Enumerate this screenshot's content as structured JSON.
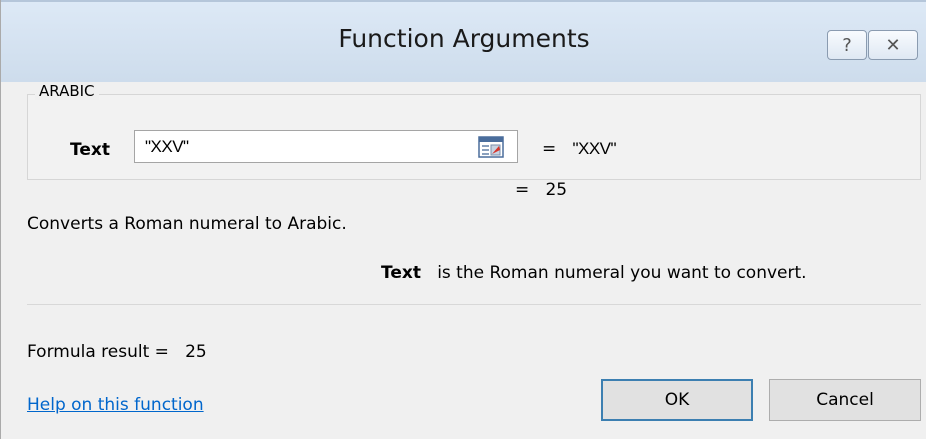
{
  "window": {
    "title": "Function Arguments",
    "help_glyph": "?",
    "close_glyph": "✕"
  },
  "function": {
    "name": "ARABIC",
    "arguments": [
      {
        "label": "Text",
        "value": "\"XXV\"",
        "evaluated_prefix": "=",
        "evaluated": "\"XXV\""
      }
    ],
    "result_prefix": "=",
    "result": "25",
    "description": "Converts a Roman numeral to Arabic.",
    "argument_help": {
      "name": "Text",
      "text": "is the Roman numeral you want to convert."
    }
  },
  "footer": {
    "formula_result_label": "Formula result =",
    "formula_result_value": "25",
    "help_link": "Help on this function",
    "ok_label": "OK",
    "cancel_label": "Cancel"
  },
  "icons": {
    "help": "question-icon",
    "close": "close-icon",
    "collapse": "collapse-dialog-icon"
  }
}
